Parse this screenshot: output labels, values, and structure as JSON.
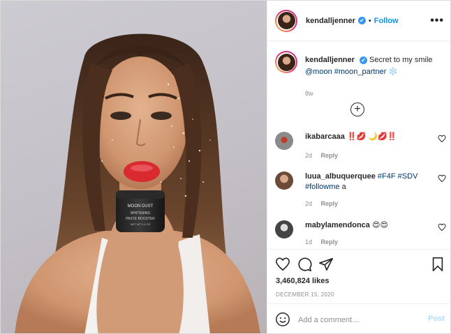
{
  "post": {
    "username": "kendalljenner",
    "verified_badge": "✔",
    "separator": "•",
    "follow_label": "Follow",
    "more_icon": "more-horizontal-icon",
    "more_label": "•••",
    "caption": {
      "username": "kendalljenner",
      "text_pre": "Secret to my smile ",
      "mention": "@moon",
      "hashtag": "#moon_partner",
      "emoji": "❄️",
      "time": "8w"
    },
    "load_more_label": "+",
    "photo": {
      "jar_brand": "MOON DUST",
      "jar_line1": "WHITENING",
      "jar_line2": "PASTE BOOSTER",
      "jar_line3": "NET WT 0.4 OZ"
    }
  },
  "comments": [
    {
      "username": "ikabarcaaa",
      "text": "‼️💋 🌙💋‼️",
      "time": "2d",
      "reply": "Reply"
    },
    {
      "username": "luua_albuquerquee",
      "tag1": "#F4F",
      "tag2": "#SDV",
      "tag3": "#followme",
      "tail": " a",
      "time": "2d",
      "reply": "Reply"
    },
    {
      "username": "mabylamendonca",
      "text": "😍😍",
      "time": "1d",
      "reply": "Reply"
    }
  ],
  "actions": {
    "likes": "3,460,824 likes",
    "date": "DECEMBER 15, 2020",
    "icons": [
      "heart-icon",
      "comment-icon",
      "share-icon",
      "bookmark-icon"
    ]
  },
  "add_comment": {
    "placeholder": "Add a comment…",
    "post_label": "Post"
  },
  "colors": {
    "accent": "#0095f6",
    "post_disabled": "#b3dbff",
    "lipstick": "#d92a2f",
    "text_muted": "#8e8e8e"
  }
}
